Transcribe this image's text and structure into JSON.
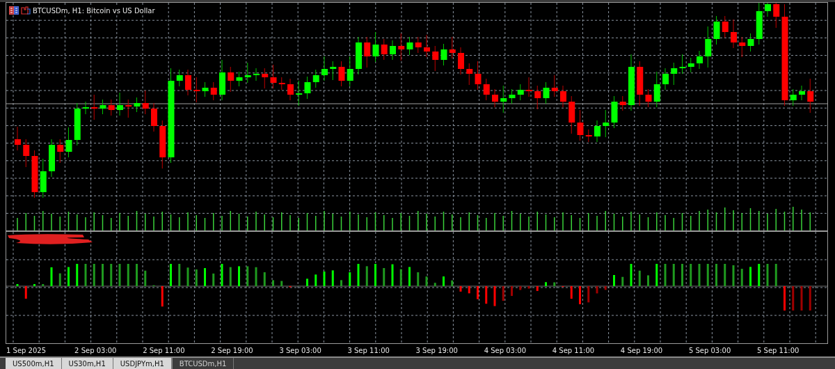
{
  "chart": {
    "title": "BTCUSDm, H1:  Bitcoin vs US Dollar",
    "time_labels": [
      "1 Sep 2025",
      "2 Sep 03:00",
      "2 Sep 11:00",
      "2 Sep 19:00",
      "3 Sep 03:00",
      "3 Sep 11:00",
      "3 Sep 19:00",
      "4 Sep 03:00",
      "4 Sep 11:00",
      "4 Sep 19:00",
      "5 Sep 03:00",
      "5 Sep 11:00"
    ]
  },
  "tabs": [
    {
      "label": "US500m,H1",
      "selected": false
    },
    {
      "label": "US30m,H1",
      "selected": false
    },
    {
      "label": "USDJPYm,H1",
      "selected": false
    },
    {
      "label": "BTCUSDm,H1",
      "selected": true
    }
  ]
}
